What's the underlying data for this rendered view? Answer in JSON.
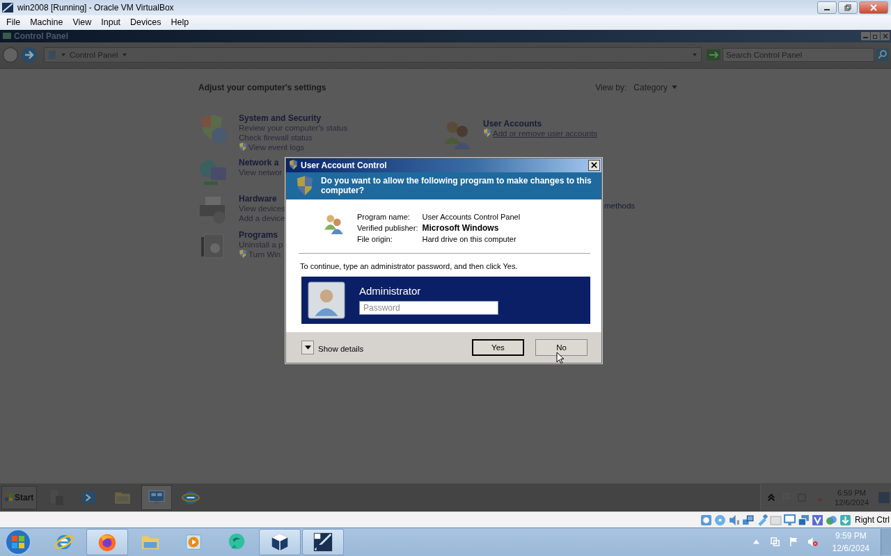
{
  "host_window": {
    "title": "win2008 [Running] - Oracle VM VirtualBox"
  },
  "menu": [
    "File",
    "Machine",
    "View",
    "Input",
    "Devices",
    "Help"
  ],
  "guest": {
    "window": {
      "title": "Control Panel"
    },
    "address": {
      "breadcrumb": "Control Panel",
      "search_placeholder": "Search Control Panel"
    },
    "heading": "Adjust your computer's settings",
    "view_by": {
      "label": "View by:",
      "value": "Category"
    },
    "categories_left": [
      {
        "kind": "security",
        "title": "System and Security",
        "links": [
          {
            "text": "Review your computer's status",
            "shield": false
          },
          {
            "text": "Check firewall status",
            "shield": false
          },
          {
            "text": "View event logs",
            "shield": true
          }
        ]
      },
      {
        "kind": "network",
        "title": "Network a",
        "links": [
          {
            "text": "View networ",
            "shield": false
          }
        ]
      },
      {
        "kind": "hardware",
        "title": "Hardware",
        "links": [
          {
            "text": "View devices",
            "shield": false
          },
          {
            "text": "Add a device",
            "shield": false
          }
        ]
      },
      {
        "kind": "programs",
        "title": "Programs",
        "links": [
          {
            "text": "Uninstall a p",
            "shield": false
          },
          {
            "text": "Turn Win",
            "shield": true
          }
        ]
      }
    ],
    "categories_right": [
      {
        "kind": "users",
        "title": "User Accounts",
        "links": [
          {
            "text": "Add or remove user accounts",
            "shield": true
          }
        ]
      }
    ],
    "partial_link": "methods",
    "taskbar": {
      "start": "Start",
      "buttons": [
        {
          "kind": "server",
          "selected": false
        },
        {
          "kind": "powershell",
          "selected": false
        },
        {
          "kind": "folder",
          "selected": false
        },
        {
          "kind": "control-panel",
          "selected": true
        },
        {
          "kind": "browser",
          "selected": false
        }
      ],
      "clock": {
        "time": "6:59 PM",
        "date": "12/6/2024"
      }
    }
  },
  "uac": {
    "title": "User Account Control",
    "question": "Do you want to allow the following program to make changes to this computer?",
    "fields": [
      {
        "label": "Program name:",
        "value": "User Accounts Control Panel",
        "bold": false
      },
      {
        "label": "Verified publisher:",
        "value": "Microsoft Windows",
        "bold": true
      },
      {
        "label": "File origin:",
        "value": "Hard drive on this computer",
        "bold": false
      }
    ],
    "instruction": "To continue, type an administrator password, and then click Yes.",
    "user": "Administrator",
    "password_placeholder": "Password",
    "details": "Show details",
    "buttons": [
      {
        "label": "Yes",
        "default": true
      },
      {
        "label": "No",
        "default": false
      }
    ]
  },
  "status_bar": {
    "host_key": "Right Ctrl"
  },
  "host_taskbar": {
    "apps": [
      {
        "kind": "browser",
        "running": false
      },
      {
        "kind": "firefox",
        "running": true
      },
      {
        "kind": "folder",
        "running": false
      },
      {
        "kind": "media",
        "running": false
      },
      {
        "kind": "chat",
        "running": false
      },
      {
        "kind": "cube",
        "running": true
      },
      {
        "kind": "server-logo",
        "running": true
      }
    ],
    "clock": {
      "time": "9:59 PM",
      "date": "12/6/2024"
    }
  }
}
